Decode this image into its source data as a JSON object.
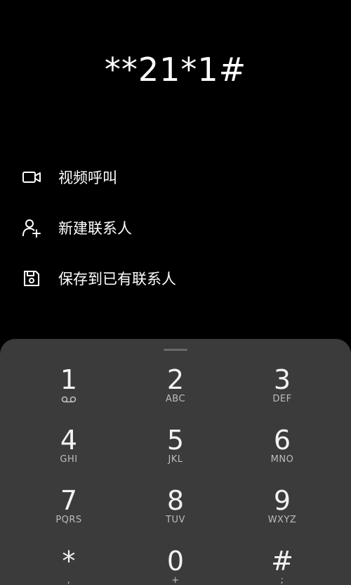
{
  "dialer": {
    "number": "**21*1#"
  },
  "actions": [
    {
      "label": "视频呼叫",
      "icon": "video-call-icon"
    },
    {
      "label": "新建联系人",
      "icon": "add-contact-icon"
    },
    {
      "label": "保存到已有联系人",
      "icon": "save-icon"
    }
  ],
  "keypad": {
    "keys": [
      {
        "digit": "1",
        "letters": "",
        "icon": "voicemail-icon"
      },
      {
        "digit": "2",
        "letters": "ABC"
      },
      {
        "digit": "3",
        "letters": "DEF"
      },
      {
        "digit": "4",
        "letters": "GHI"
      },
      {
        "digit": "5",
        "letters": "JKL"
      },
      {
        "digit": "6",
        "letters": "MNO"
      },
      {
        "digit": "7",
        "letters": "PQRS"
      },
      {
        "digit": "8",
        "letters": "TUV"
      },
      {
        "digit": "9",
        "letters": "WXYZ"
      },
      {
        "digit": "*",
        "letters": ","
      },
      {
        "digit": "0",
        "letters": "+"
      },
      {
        "digit": "#",
        "letters": ";"
      }
    ]
  },
  "colors": {
    "background": "#000000",
    "keypad_background": "#3b3b3b",
    "text": "#ffffff",
    "subtext": "#bdbdbd"
  }
}
